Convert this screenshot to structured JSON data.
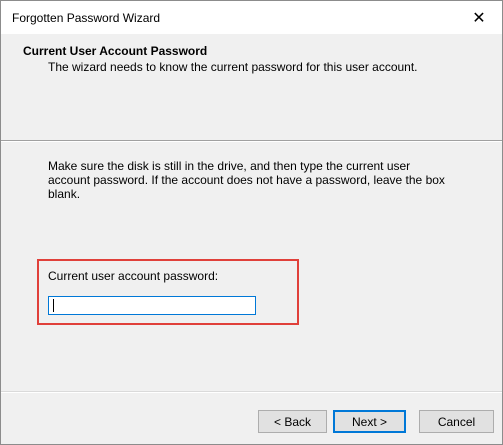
{
  "window": {
    "title": "Forgotten Password Wizard",
    "close_glyph": "✕"
  },
  "header": {
    "title": "Current User Account Password",
    "subtitle": "The wizard needs to know the current password for this user account."
  },
  "main": {
    "instruction": "Make sure the disk is still in the drive, and then type the current user account password. If the account does not have a password, leave the box blank.",
    "password_label": "Current user account password:",
    "password_value": ""
  },
  "buttons": {
    "back": "< Back",
    "next": "Next >",
    "cancel": "Cancel"
  },
  "colors": {
    "highlight": "#e0403a",
    "focus": "#0078d7"
  }
}
